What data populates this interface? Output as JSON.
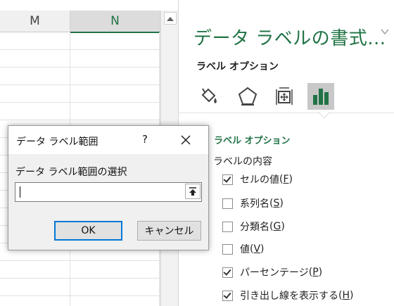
{
  "sheet": {
    "columns": [
      "M",
      "N"
    ]
  },
  "pane": {
    "title": "データ ラベルの書式...",
    "subtitle": "ラベル オプション",
    "tabs": [
      "fill-line-icon",
      "effects-icon",
      "size-properties-icon",
      "bar-chart-icon"
    ],
    "section_heading": "ラベル オプション",
    "contents_label": "ラベルの内容",
    "options": [
      {
        "label": "セルの値",
        "key": "F",
        "checked": true
      },
      {
        "label": "系列名",
        "key": "S",
        "checked": false
      },
      {
        "label": "分類名",
        "key": "G",
        "checked": false
      },
      {
        "label": "値",
        "key": "V",
        "checked": false
      },
      {
        "label": "パーセンテージ",
        "key": "P",
        "checked": true
      },
      {
        "label": "引き出し線を表示する",
        "key": "H",
        "checked": true
      }
    ]
  },
  "dialog": {
    "title": "データ ラベル範囲",
    "help": "?",
    "prompt": "データ ラベル範囲の選択",
    "input_value": "",
    "ok_label": "OK",
    "cancel_label": "キャンセル"
  },
  "colors": {
    "accent_green": "#217346",
    "focus_blue": "#0078d7"
  }
}
